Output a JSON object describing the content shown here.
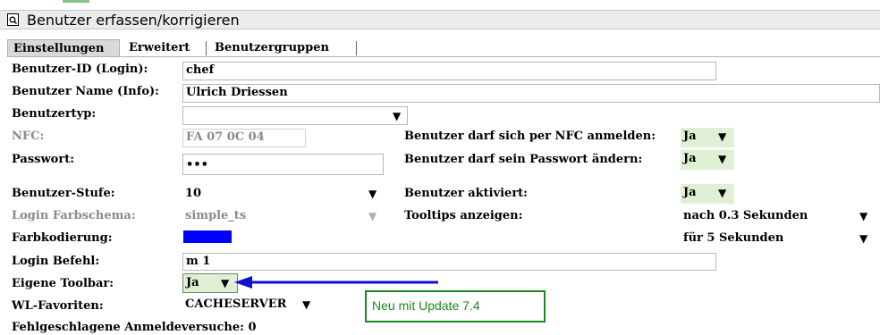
{
  "window": {
    "title": "Benutzer erfassen/korrigieren"
  },
  "tabs": [
    {
      "label": "Einstellungen",
      "active": true
    },
    {
      "label": "Erweitert",
      "active": false
    },
    {
      "label": "Benutzergruppen",
      "active": false
    }
  ],
  "form": {
    "login_id": {
      "label": "Benutzer-ID (Login):",
      "value": "chef"
    },
    "user_name": {
      "label": "Benutzer Name (Info):",
      "value": "Ulrich Driessen"
    },
    "user_type": {
      "label": "Benutzertyp:",
      "value": ""
    },
    "nfc": {
      "label": "NFC:",
      "value": "FA 07 0C 04"
    },
    "password": {
      "label": "Passwort:",
      "value": "•••"
    },
    "user_level": {
      "label": "Benutzer-Stufe:",
      "value": "10"
    },
    "login_color_scheme": {
      "label": "Login Farbschema:",
      "value": "simple_ts"
    },
    "color_coding": {
      "label": "Farbkodierung:",
      "color": "#0000ff"
    },
    "login_command": {
      "label": "Login Befehl:",
      "value": "m 1"
    },
    "own_toolbar": {
      "label": "Eigene Toolbar:",
      "value": "Ja"
    },
    "wl_favorites": {
      "label": "WL-Favoriten:",
      "value": "CACHESERVER"
    },
    "failed_logins": {
      "label": "Fehlgeschlagene Anmeldeversuche: 0"
    },
    "nfc_login_allowed": {
      "label": "Benutzer darf sich per NFC anmelden:",
      "value": "Ja"
    },
    "change_password_allowed": {
      "label": "Benutzer darf sein Passwort ändern:",
      "value": "Ja"
    },
    "user_active": {
      "label": "Benutzer aktiviert:",
      "value": "Ja"
    },
    "tooltips": {
      "label": "Tooltips anzeigen:",
      "delay": "nach 0.3 Sekunden",
      "duration": "für 5 Sekunden"
    }
  },
  "annotation": {
    "text": "Neu mit Update 7.4",
    "color": "#1b8a1b",
    "arrow_color": "#1010d0"
  }
}
